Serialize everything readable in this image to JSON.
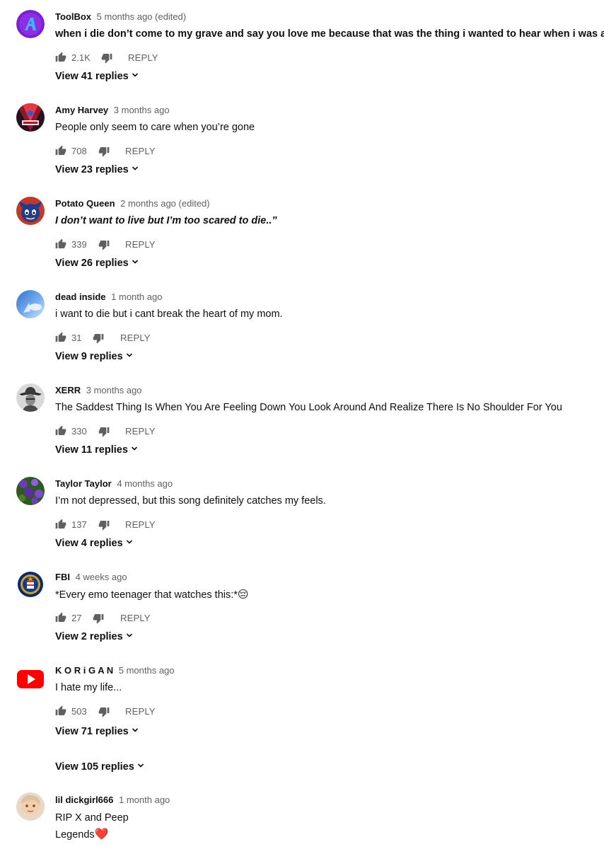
{
  "comments": [
    {
      "author": "ToolBox",
      "time": "5 months ago (edited)",
      "text": "when i die don’t come to my grave and say you love me because that was the thing i wanted to hear when i was alive",
      "likes": "2.1K",
      "reply_label": "REPLY",
      "view_replies": "View 41 replies",
      "avatar_icon": "toolbox-logo-icon"
    },
    {
      "author": "Amy Harvey",
      "time": "3 months ago",
      "text": "People only seem to care when you’re gone",
      "likes": "708",
      "reply_label": "REPLY",
      "view_replies": "View 23 replies",
      "avatar_icon": "poster-avatar-icon"
    },
    {
      "author": "Potato Queen",
      "time": "2 months ago (edited)",
      "text": "I don’t want to live but I’m too scared to die..”",
      "likes": "339",
      "reply_label": "REPLY",
      "view_replies": "View 26 replies",
      "avatar_icon": "cartoon-avatar-icon"
    },
    {
      "author": "dead inside",
      "time": "1 month ago",
      "text": "i want to die but i cant break the heart of my mom.",
      "likes": "31",
      "reply_label": "REPLY",
      "view_replies": "View 9 replies",
      "avatar_icon": "sky-avatar-icon"
    },
    {
      "author": "XERR",
      "time": "3 months ago",
      "text": "The Saddest Thing Is When You Are Feeling Down You Look Around And Realize There Is No Shoulder For You",
      "likes": "330",
      "reply_label": "REPLY",
      "view_replies": "View 11 replies",
      "avatar_icon": "cowboy-avatar-icon"
    },
    {
      "author": "Taylor Taylor",
      "time": "4 months ago",
      "text": "I’m not depressed, but this song definitely catches my feels.",
      "likes": "137",
      "reply_label": "REPLY",
      "view_replies": "View 4 replies",
      "avatar_icon": "flowers-avatar-icon"
    },
    {
      "author": "FBI",
      "time": "4 weeks ago",
      "text": "*Every emo teenager that watches this:*",
      "text_emoji": "😔",
      "likes": "27",
      "reply_label": "REPLY",
      "view_replies": "View 2 replies",
      "avatar_icon": "fbi-seal-icon"
    },
    {
      "author": "K O R i G A N",
      "time": "5 months ago",
      "text": "I hate my life...",
      "likes": "503",
      "reply_label": "REPLY",
      "view_replies": "View 71 replies",
      "avatar_icon": "youtube-logo-icon"
    }
  ],
  "standalone_view_replies": "View 105 replies",
  "last_comment": {
    "author": "lil dickgirl666",
    "time": "1 month ago",
    "line1": "RIP X and Peep",
    "line2": "Legends",
    "line2_emoji": "❤️",
    "avatar_icon": "photo-avatar-icon"
  },
  "colors": {
    "secondary_text": "#606060",
    "primary_text": "#0f0f0f",
    "youtube_red": "#ff0000"
  }
}
